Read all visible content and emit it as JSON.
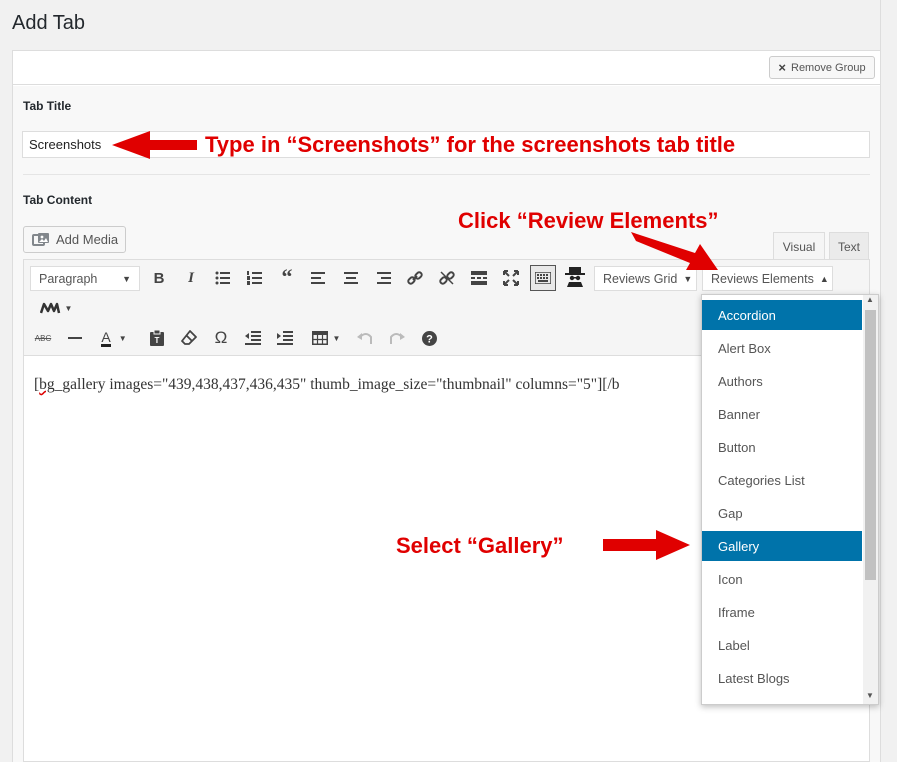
{
  "page": {
    "title": "Add Tab"
  },
  "group": {
    "remove_label": "Remove Group"
  },
  "fields": {
    "tab_title_label": "Tab Title",
    "tab_title_value": "Screenshots",
    "tab_content_label": "Tab Content"
  },
  "editor": {
    "add_media_label": "Add Media",
    "tabs": {
      "visual": "Visual",
      "text": "Text"
    },
    "format_select": "Paragraph",
    "reviews_grid_label": "Reviews Grid",
    "reviews_elements_label": "Reviews Elements",
    "content_misspelled": "bg",
    "content_rest": "_gallery images=\"439,438,437,436,435\" thumb_image_size=\"thumbnail\" columns=\"5\"][/b",
    "content_prefix": "["
  },
  "dropdown": {
    "items": [
      "Accordion",
      "Alert Box",
      "Authors",
      "Banner",
      "Button",
      "Categories List",
      "Gap",
      "Gallery",
      "Icon",
      "Iframe",
      "Label",
      "Latest Blogs"
    ],
    "highlighted": [
      "Accordion",
      "Gallery"
    ]
  },
  "annotations": {
    "type_in": "Type in “Screenshots” for the screenshots tab title",
    "click": "Click “Review Elements”",
    "select": "Select “Gallery”"
  },
  "colors": {
    "accent": "#0073aa",
    "annotation": "#e00000"
  }
}
